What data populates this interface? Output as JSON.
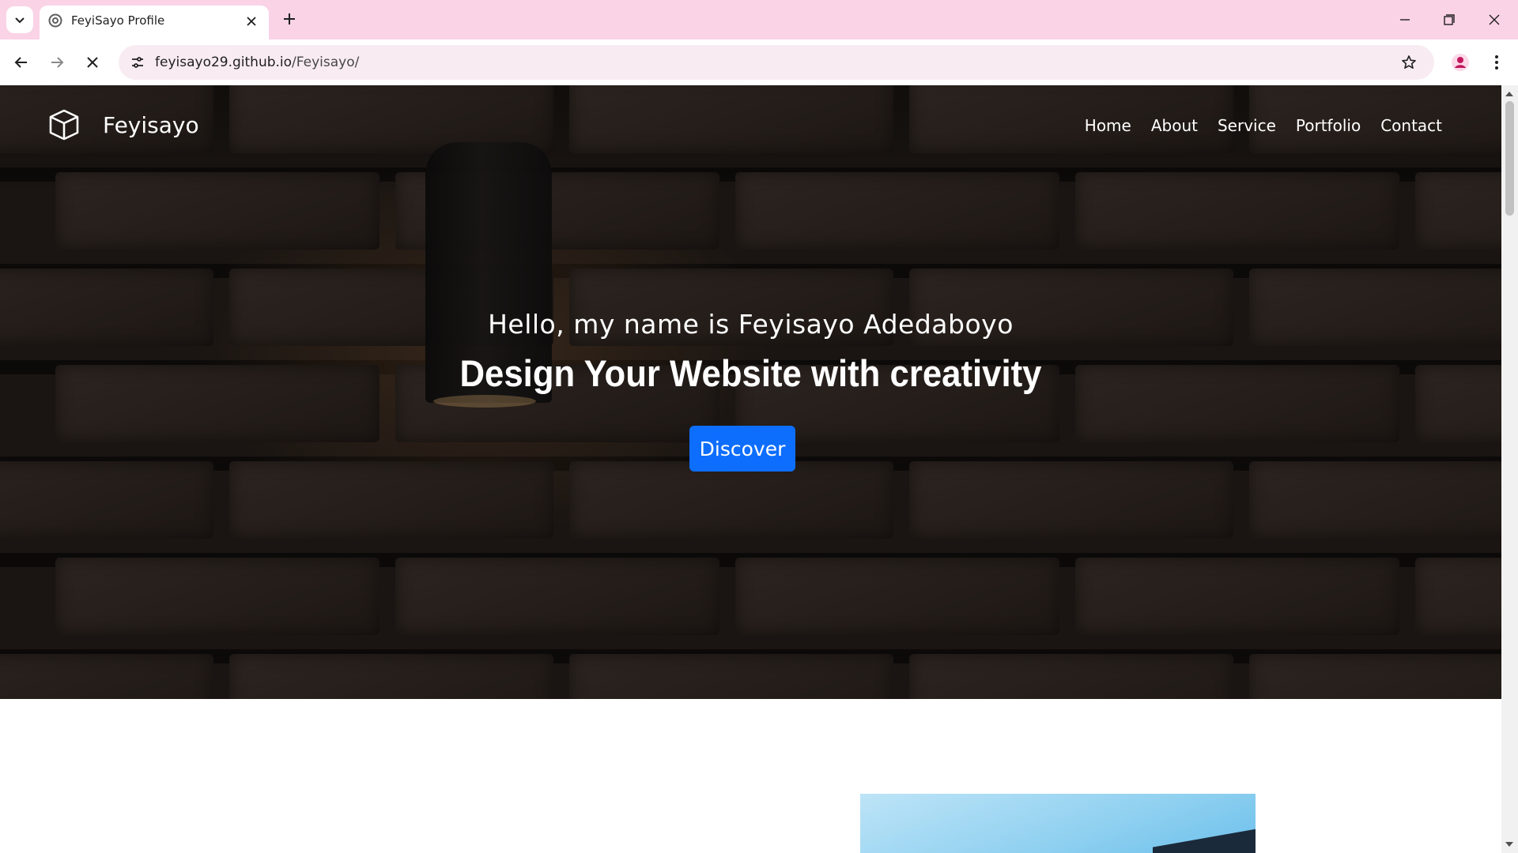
{
  "browser": {
    "tab": {
      "title": "FeyiSayo Profile"
    },
    "address_bar": {
      "domain": "feyisayo29.github.io",
      "path": "/Feyisayo/"
    },
    "icons": [
      "tab-search-icon",
      "favicon-icon",
      "close-icon",
      "plus-icon",
      "minimize-icon",
      "restore-icon",
      "window-close-icon",
      "back-arrow-icon",
      "forward-arrow-icon",
      "stop-loading-icon",
      "site-info-icon",
      "star-icon",
      "profile-icon",
      "kebab-menu-icon"
    ]
  },
  "site": {
    "brand": "Feyisayo",
    "nav": [
      {
        "label": "Home"
      },
      {
        "label": "About"
      },
      {
        "label": "Service"
      },
      {
        "label": "Portfolio"
      },
      {
        "label": "Contact"
      }
    ],
    "hero": {
      "subtitle": "Hello, my name is Feyisayo Adedaboyo",
      "title": "Design Your Website with creativity",
      "cta": "Discover"
    },
    "colors": {
      "accent": "#0d6efd",
      "chrome": "#fad3e6",
      "omnibox": "#f8ebf1"
    }
  }
}
